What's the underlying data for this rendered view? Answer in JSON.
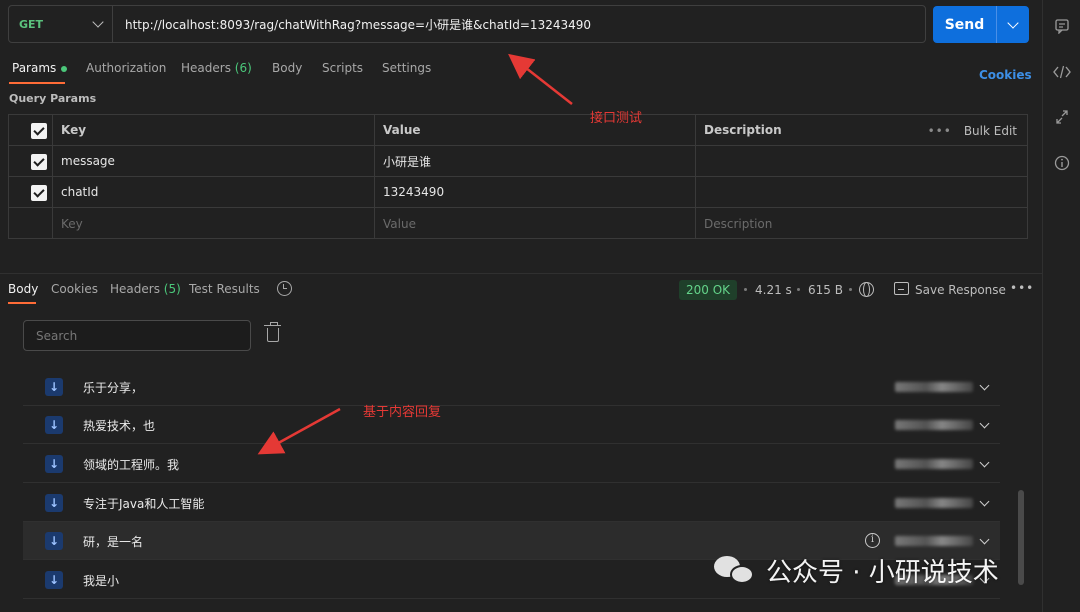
{
  "request": {
    "method": "GET",
    "url": "http://localhost:8093/rag/chatWithRag?message=小研是谁&chatId=13243490",
    "send_label": "Send"
  },
  "request_tabs": [
    {
      "label": "Params",
      "active": true
    },
    {
      "label": "Authorization"
    },
    {
      "label": "Headers",
      "count": "(6)"
    },
    {
      "label": "Body"
    },
    {
      "label": "Scripts"
    },
    {
      "label": "Settings"
    }
  ],
  "cookies_link": "Cookies",
  "query_params": {
    "section_label": "Query Params",
    "headers": {
      "key": "Key",
      "value": "Value",
      "description": "Description",
      "bulk_edit": "Bulk Edit",
      "dots": "•••"
    },
    "rows": [
      {
        "key": "message",
        "value": "小研是谁",
        "description": ""
      },
      {
        "key": "chatId",
        "value": "13243490",
        "description": ""
      }
    ],
    "placeholders": {
      "key": "Key",
      "value": "Value",
      "description": "Description"
    }
  },
  "response_tabs": [
    {
      "label": "Body",
      "active": true
    },
    {
      "label": "Cookies"
    },
    {
      "label": "Headers",
      "count": "(5)"
    },
    {
      "label": "Test Results"
    }
  ],
  "response_meta": {
    "status": "200 OK",
    "time": "4.21 s",
    "size": "615 B",
    "save_response": "Save Response",
    "more": "•••"
  },
  "search": {
    "placeholder": "Search"
  },
  "messages": [
    {
      "text": "乐于分享，"
    },
    {
      "text": "热爱技术，也"
    },
    {
      "text": "领域的工程师。我"
    },
    {
      "text": "专注于Java和人工智能"
    },
    {
      "text": "研，是一名",
      "hover": true
    },
    {
      "text": "我是小"
    }
  ],
  "annotations": {
    "api_test": "接口测试",
    "content_reply": "基于内容回复"
  },
  "watermark": "公众号 · 小研说技术",
  "colors": {
    "send_button": "#0e6fdd",
    "method_get": "#5bc27d",
    "status_ok": "#64d38a",
    "annotation": "#e53935",
    "active_tab_underline": "#ff6c37"
  },
  "icons": {
    "rail": [
      "comment-icon",
      "code-icon",
      "arrows-icon",
      "info-icon"
    ],
    "message_direction": "arrow-down-icon"
  }
}
